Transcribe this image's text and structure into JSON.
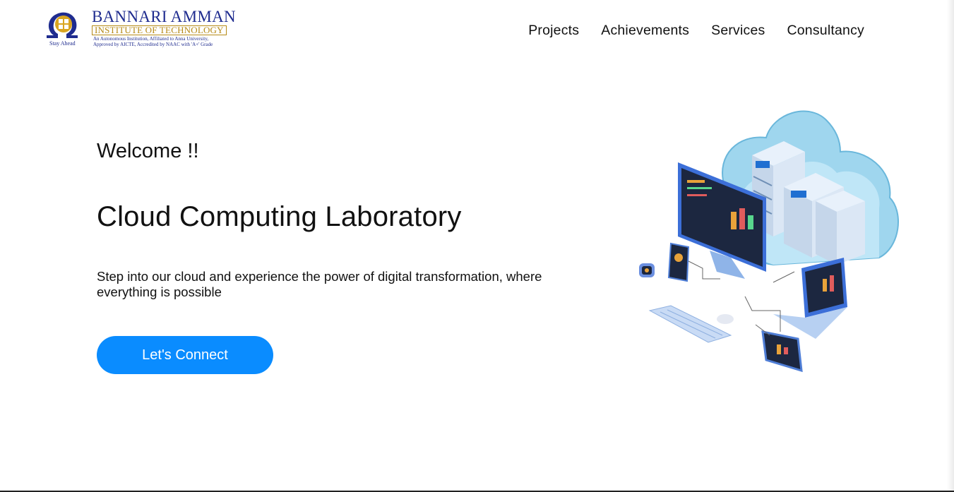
{
  "header": {
    "logo": {
      "name": "BANNARI AMMAN",
      "subtitle": "INSTITUTE OF TECHNOLOGY",
      "line1": "An Autonomous Institution, Affiliated to Anna University,",
      "line2": "Approved by AICTE, Accredited by NAAC with 'A+' Grade",
      "tagline": "Stay Ahead"
    },
    "nav": [
      {
        "label": "Projects"
      },
      {
        "label": "Achievements"
      },
      {
        "label": "Services"
      },
      {
        "label": "Consultancy"
      }
    ]
  },
  "hero": {
    "welcome": "Welcome !!",
    "title": "Cloud Computing Laboratory",
    "description": "Step into our cloud and experience the power of digital transformation, where everything is possible",
    "cta_label": "Let's Connect",
    "illustration": "cloud-computing-illustration"
  },
  "colors": {
    "accent": "#0a8cff",
    "logo_blue": "#1f2c8f",
    "logo_gold": "#b68a16"
  }
}
